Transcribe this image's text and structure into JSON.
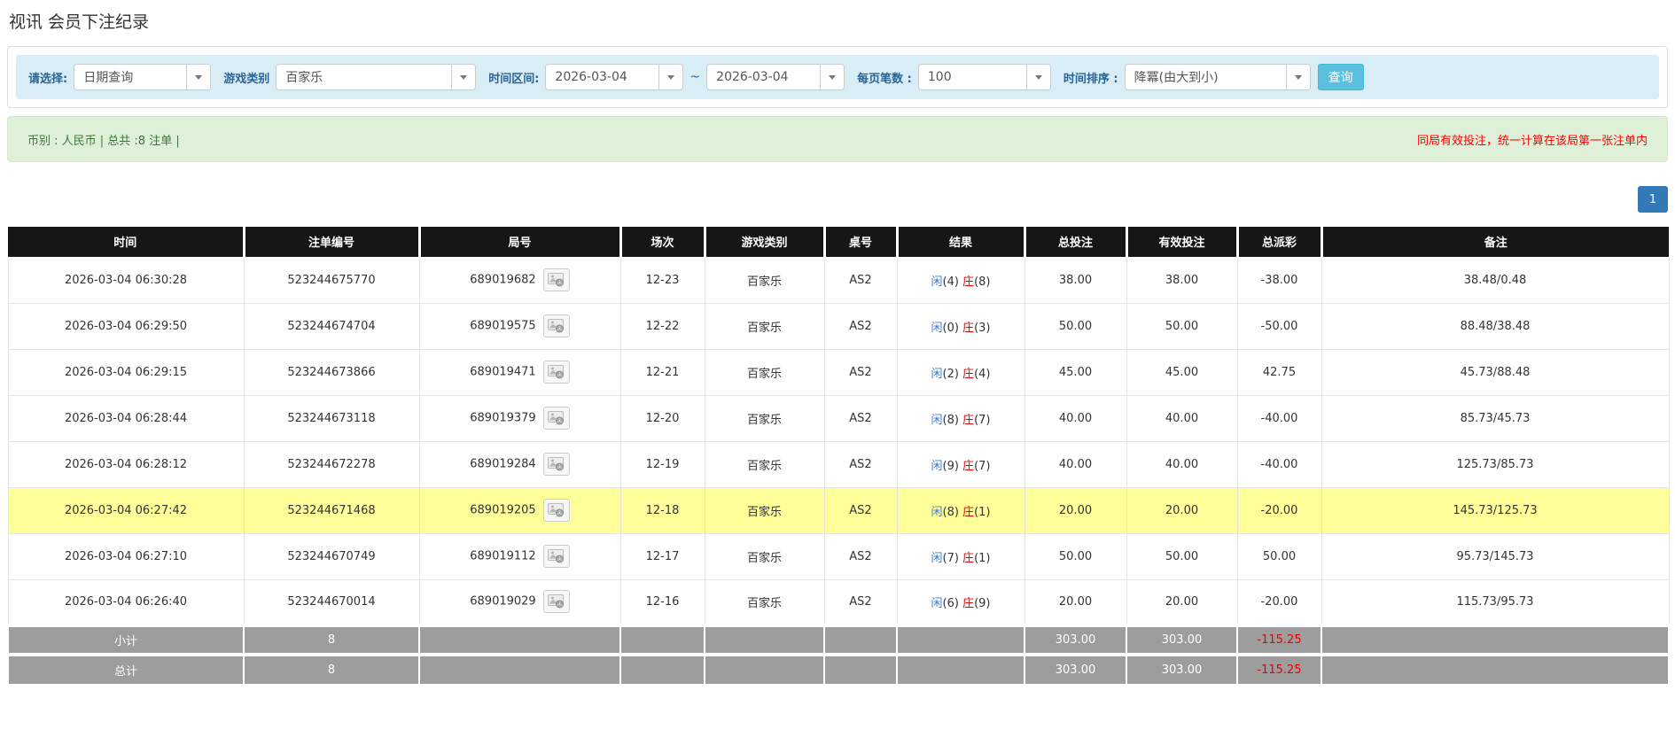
{
  "page": {
    "title": "视讯 会员下注纪录"
  },
  "filters": {
    "select_type": {
      "label": "请选择:",
      "value": "日期查询"
    },
    "game_type": {
      "label": "游戏类别",
      "value": "百家乐"
    },
    "date_range": {
      "label": "时间区间:",
      "from": "2026-03-04",
      "separator": "~",
      "to": "2026-03-04"
    },
    "page_size": {
      "label": "每页笔数 :",
      "value": "100"
    },
    "sort": {
      "label": "时间排序 :",
      "value": "降冪(由大到小)"
    },
    "query_label": "查询"
  },
  "summary": {
    "left": "币别 : 人民币 | 总共 :8 注单 |",
    "note": "同局有效投注，统一计算在该局第一张注单内"
  },
  "pagination": {
    "current": "1"
  },
  "icons": {
    "dropdown": "chevron-down",
    "round_media": "video-photo-thumbnail"
  },
  "colors": {
    "filter_bg": "#d9edf7",
    "filter_label": "#2a6496",
    "button_info": "#5bc0de",
    "pagination_blue": "#337ab7",
    "alert_green_bg": "#dff0d8",
    "alert_green_text": "#3c763d",
    "alert_red_text": "#fe0000",
    "header_bg": "#161616",
    "highlight_row": "#ffff99",
    "value_blue": "#3d7fd6",
    "value_red": "#e60000",
    "totals_bg": "#9d9d9d"
  },
  "table": {
    "columns": [
      "时间",
      "注单编号",
      "局号",
      "场次",
      "游戏类别",
      "桌号",
      "结果",
      "总投注",
      "有效投注",
      "总派彩",
      "备注"
    ],
    "result_labels": {
      "player": "闲",
      "banker": "庄"
    },
    "rows": [
      {
        "time": "2026-03-04 06:30:28",
        "bet_id": "523244675770",
        "round_id": "689019682",
        "session": "12-23",
        "game": "百家乐",
        "table": "AS2",
        "player": "4",
        "banker": "8",
        "total_bet": "38.00",
        "valid_bet": "38.00",
        "payout": "-38.00",
        "remark": "38.48/0.48",
        "highlighted": false
      },
      {
        "time": "2026-03-04 06:29:50",
        "bet_id": "523244674704",
        "round_id": "689019575",
        "session": "12-22",
        "game": "百家乐",
        "table": "AS2",
        "player": "0",
        "banker": "3",
        "total_bet": "50.00",
        "valid_bet": "50.00",
        "payout": "-50.00",
        "remark": "88.48/38.48",
        "highlighted": false
      },
      {
        "time": "2026-03-04 06:29:15",
        "bet_id": "523244673866",
        "round_id": "689019471",
        "session": "12-21",
        "game": "百家乐",
        "table": "AS2",
        "player": "2",
        "banker": "4",
        "total_bet": "45.00",
        "valid_bet": "45.00",
        "payout": "42.75",
        "remark": "45.73/88.48",
        "highlighted": false
      },
      {
        "time": "2026-03-04 06:28:44",
        "bet_id": "523244673118",
        "round_id": "689019379",
        "session": "12-20",
        "game": "百家乐",
        "table": "AS2",
        "player": "8",
        "banker": "7",
        "total_bet": "40.00",
        "valid_bet": "40.00",
        "payout": "-40.00",
        "remark": "85.73/45.73",
        "highlighted": false
      },
      {
        "time": "2026-03-04 06:28:12",
        "bet_id": "523244672278",
        "round_id": "689019284",
        "session": "12-19",
        "game": "百家乐",
        "table": "AS2",
        "player": "9",
        "banker": "7",
        "total_bet": "40.00",
        "valid_bet": "40.00",
        "payout": "-40.00",
        "remark": "125.73/85.73",
        "highlighted": false
      },
      {
        "time": "2026-03-04 06:27:42",
        "bet_id": "523244671468",
        "round_id": "689019205",
        "session": "12-18",
        "game": "百家乐",
        "table": "AS2",
        "player": "8",
        "banker": "1",
        "total_bet": "20.00",
        "valid_bet": "20.00",
        "payout": "-20.00",
        "remark": "145.73/125.73",
        "highlighted": true
      },
      {
        "time": "2026-03-04 06:27:10",
        "bet_id": "523244670749",
        "round_id": "689019112",
        "session": "12-17",
        "game": "百家乐",
        "table": "AS2",
        "player": "7",
        "banker": "1",
        "total_bet": "50.00",
        "valid_bet": "50.00",
        "payout": "50.00",
        "remark": "95.73/145.73",
        "highlighted": false
      },
      {
        "time": "2026-03-04 06:26:40",
        "bet_id": "523244670014",
        "round_id": "689019029",
        "session": "12-16",
        "game": "百家乐",
        "table": "AS2",
        "player": "6",
        "banker": "9",
        "total_bet": "20.00",
        "valid_bet": "20.00",
        "payout": "-20.00",
        "remark": "115.73/95.73",
        "highlighted": false
      }
    ],
    "totals": [
      {
        "label": "小计",
        "count": "8",
        "total_bet": "303.00",
        "valid_bet": "303.00",
        "payout": "-115.25"
      },
      {
        "label": "总计",
        "count": "8",
        "total_bet": "303.00",
        "valid_bet": "303.00",
        "payout": "-115.25"
      }
    ]
  }
}
